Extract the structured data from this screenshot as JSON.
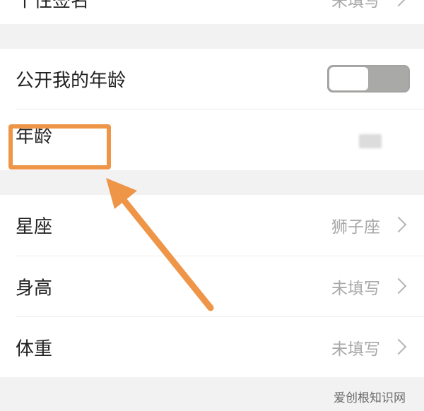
{
  "top_row": {
    "label": "个性签名",
    "value": "未填写"
  },
  "privacy": {
    "show_age_label": "公开我的年龄",
    "show_age_enabled": false,
    "age_label": "年龄"
  },
  "profile": {
    "items": [
      {
        "label": "星座",
        "value": "狮子座"
      },
      {
        "label": "身高",
        "value": "未填写"
      },
      {
        "label": "体重",
        "value": "未填写"
      }
    ]
  },
  "annotation": {
    "color": "#ee9548"
  },
  "watermark": "爱创根知识网"
}
